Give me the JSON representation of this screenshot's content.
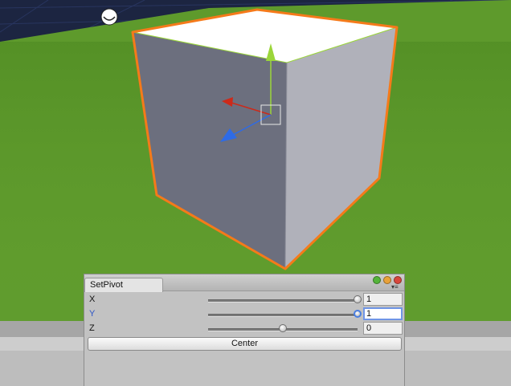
{
  "scene": {
    "colors": {
      "sky": "#1c2541",
      "grass": "#5e9a2c",
      "cube_top": "#ffffff",
      "cube_left": "#6c6f7e",
      "cube_right": "#b0b1ba",
      "selection_outline": "#f57a1a",
      "axis_x": "#cc2a1a",
      "axis_y": "#9bd63a",
      "axis_z": "#2e6be6"
    },
    "icons": [
      "light-icon",
      "move-gizmo-icon"
    ]
  },
  "panel": {
    "tab_label": "SetPivot",
    "menu_icon": "▾≡",
    "window_buttons": {
      "minimize_color": "#55b43a",
      "zoom_color": "#e8a23a",
      "close_color": "#d8473d"
    },
    "rows": [
      {
        "label": "X",
        "value": "1",
        "level": 1.0,
        "active": false
      },
      {
        "label": "Y",
        "value": "1",
        "level": 1.0,
        "active": true
      },
      {
        "label": "Z",
        "value": "0",
        "level": 0.5,
        "active": false
      }
    ],
    "center_button_label": "Center"
  }
}
